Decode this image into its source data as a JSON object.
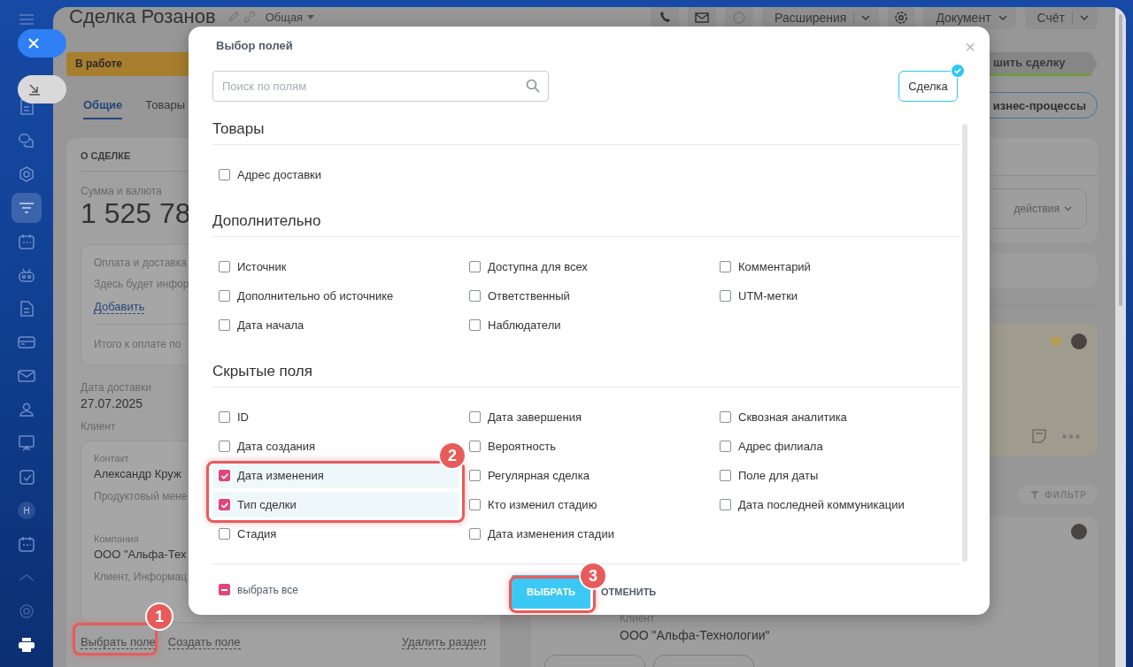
{
  "sidebar": {
    "avatar_letter": "H"
  },
  "deal": {
    "title": "Сделка Розанов",
    "category": "Общая",
    "stage": "В работе",
    "stage_next": "шить сделку",
    "toolbar": [
      {
        "label": "Расширения",
        "kind": "split"
      },
      {
        "label": "Документ",
        "kind": "dropdown"
      },
      {
        "label": "Счёт",
        "kind": "split"
      }
    ],
    "tabs": [
      {
        "label": "Общие",
        "selected": true
      },
      {
        "label": "Товары",
        "selected": false
      }
    ],
    "business_processes": "изнес-процессы",
    "actions": "действия",
    "filter": "ФИЛЬТР"
  },
  "about": {
    "heading": "О СДЕЛКЕ",
    "amount_label": "Сумма и валюта",
    "amount": "1 525 78",
    "payment_title": "Оплата и доставка",
    "payment_text": "Здесь будет инфор",
    "payment_link": "Добавить",
    "total": "Итого к оплате по",
    "delivery_label": "Дата доставки",
    "delivery_date": "27.07.2025",
    "client_label": "Клиент",
    "contact_label": "Контакт",
    "contact_name": "Александр Круж",
    "contact_role": "Продуктовый мене",
    "company_label": "Компания",
    "company_name": "ООО \"Альфа-Тех",
    "company_info": "Клиент, Информац",
    "links": [
      "Выбрать поле",
      "Создать поле",
      "Удалить раздел"
    ]
  },
  "activity": {
    "client_label": "Клиент",
    "client_name": "ООО \"Альфа-Технологии\""
  },
  "dialog": {
    "title": "Выбор полей",
    "close": "×",
    "search": {
      "placeholder": "Поиск по полям"
    },
    "entities": [
      {
        "label": "Сделка",
        "selected": true
      }
    ],
    "sections": [
      {
        "title": "Товары",
        "fields": [
          {
            "label": "Адрес доставки",
            "checked": false
          }
        ]
      },
      {
        "title": "Дополнительно",
        "fields": [
          {
            "label": "Источник",
            "checked": false
          },
          {
            "label": "Доступна для всех",
            "checked": false
          },
          {
            "label": "Комментарий",
            "checked": false
          },
          {
            "label": "Дополнительно об источнике",
            "checked": false
          },
          {
            "label": "Ответственный",
            "checked": false
          },
          {
            "label": "UTM-метки",
            "checked": false
          },
          {
            "label": "Дата начала",
            "checked": false
          },
          {
            "label": "Наблюдатели",
            "checked": false
          }
        ]
      },
      {
        "title": "Скрытые поля",
        "fields": [
          {
            "label": "ID",
            "checked": false
          },
          {
            "label": "Дата завершения",
            "checked": false
          },
          {
            "label": "Сквозная аналитика",
            "checked": false
          },
          {
            "label": "Дата создания",
            "checked": false
          },
          {
            "label": "Вероятность",
            "checked": false
          },
          {
            "label": "Адрес филиала",
            "checked": false
          },
          {
            "label": "Дата изменения",
            "checked": true
          },
          {
            "label": "Регулярная сделка",
            "checked": false
          },
          {
            "label": "Поле для даты",
            "checked": false
          },
          {
            "label": "Тип сделки",
            "checked": true
          },
          {
            "label": "Кто изменил стадию",
            "checked": false
          },
          {
            "label": "Дата последней коммуникации",
            "checked": false
          },
          {
            "label": "Стадия",
            "checked": false
          },
          {
            "label": "Дата изменения стадии",
            "checked": false
          }
        ]
      }
    ],
    "select_all": {
      "label": "выбрать все",
      "indeterminate": true
    },
    "buttons": [
      {
        "label": "ВЫБРАТЬ",
        "kind": "primary"
      },
      {
        "label": "ОТМЕНИТЬ",
        "kind": "link"
      }
    ]
  },
  "annotations": [
    "1",
    "2",
    "3"
  ]
}
